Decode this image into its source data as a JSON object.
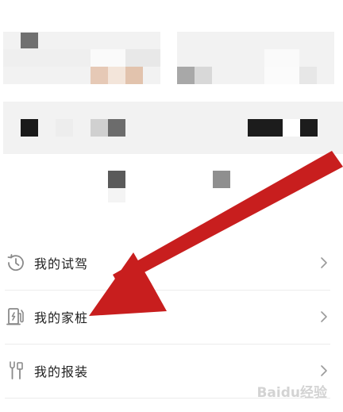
{
  "menu": {
    "items": [
      {
        "label": "我的试驾",
        "icon": "clock-history-icon"
      },
      {
        "label": "我的家桩",
        "icon": "charging-pile-icon"
      },
      {
        "label": "我的报装",
        "icon": "tools-icon"
      }
    ]
  },
  "colors": {
    "arrow": "#c81e1e",
    "card_bg": "#f2f2f2",
    "label": "#222222"
  },
  "watermark": "Baidu经验"
}
